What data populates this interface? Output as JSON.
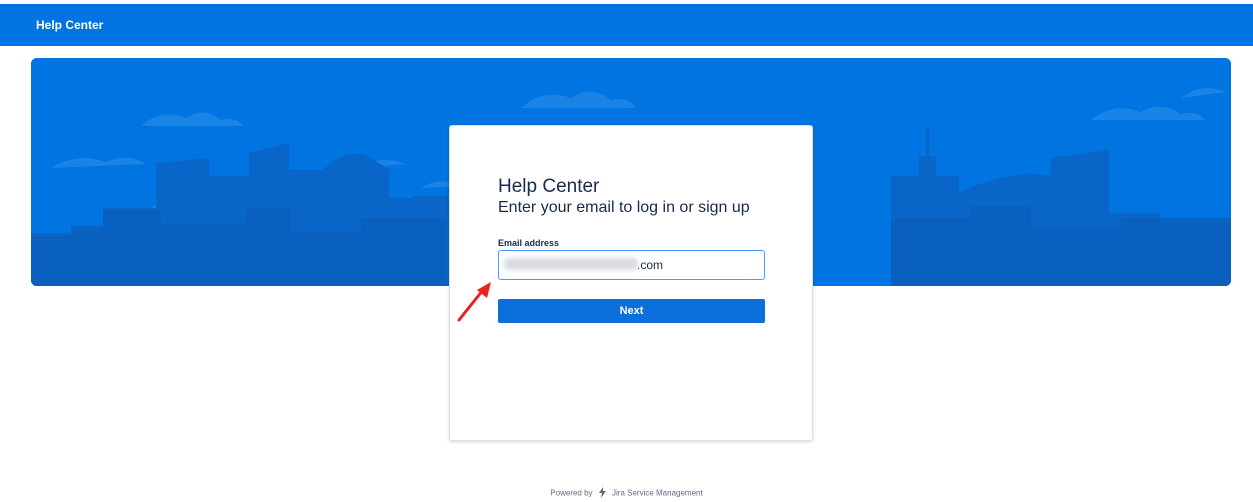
{
  "header": {
    "title": "Help Center"
  },
  "login_card": {
    "title": "Help Center",
    "subtitle": "Enter your email to log in or sign up",
    "email_label": "Email address",
    "email_value_visible": ".com",
    "next_label": "Next"
  },
  "footer": {
    "powered_by": "Powered by",
    "product": "Jira Service Management"
  },
  "colors": {
    "brand_blue": "#0074e0",
    "button_blue": "#0b6fdc",
    "annotation_red": "#e8211e"
  }
}
